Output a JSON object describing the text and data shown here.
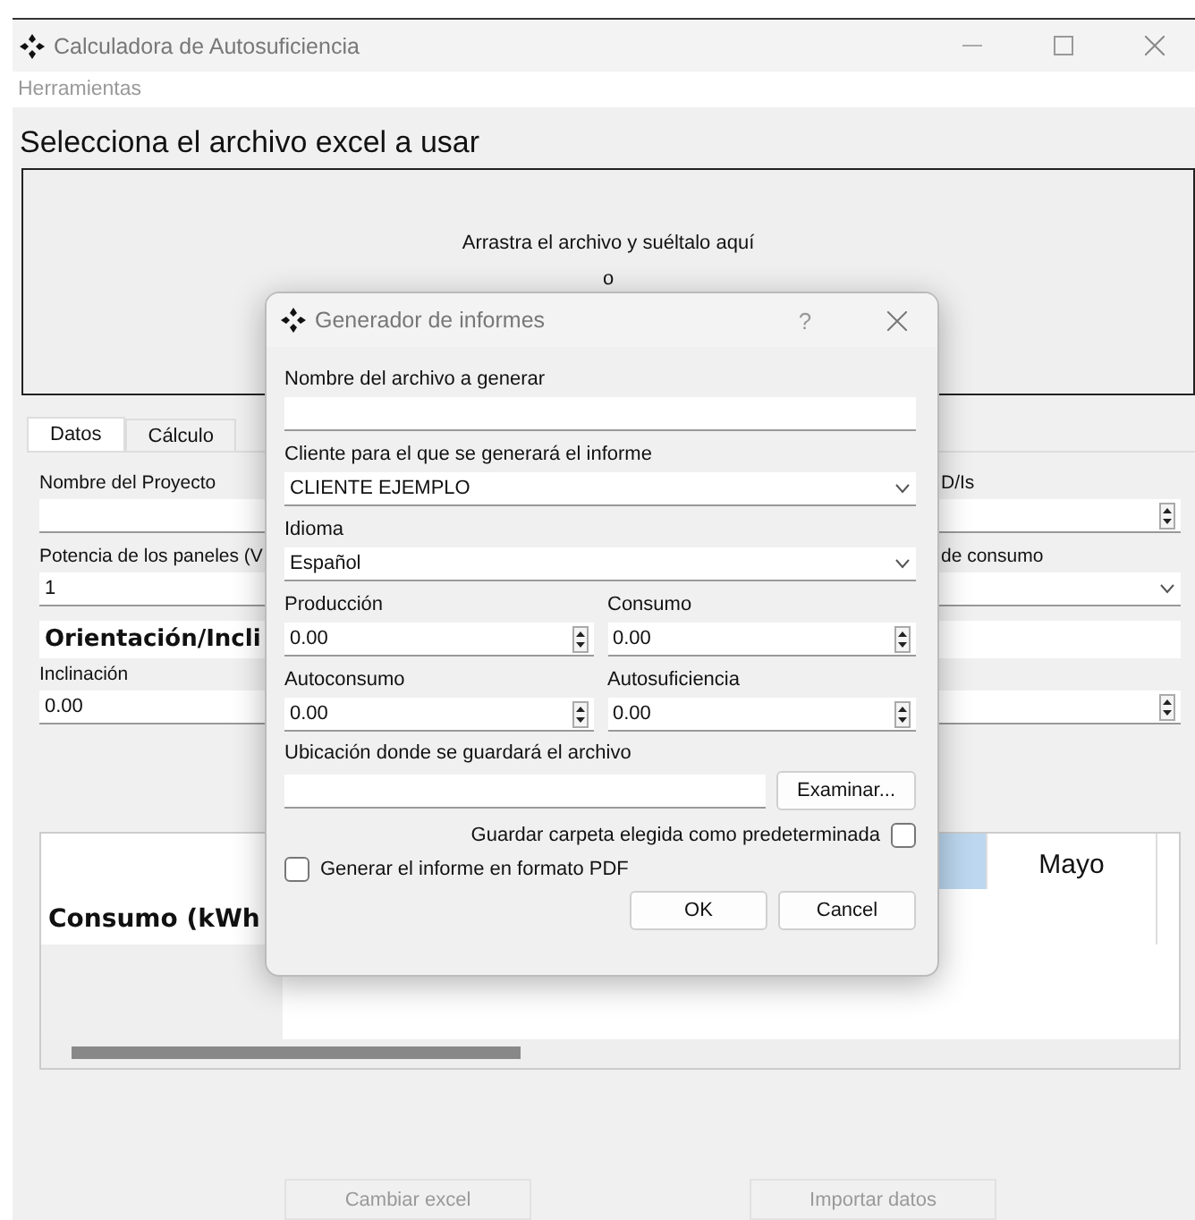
{
  "window": {
    "title": "Calculadora de Autosuficiencia"
  },
  "menu": [
    "Herramientas"
  ],
  "heading": "Selecciona el archivo excel a usar",
  "drop_zone": {
    "lines": [
      "Arrastra el archivo y suéltalo aquí",
      "o"
    ]
  },
  "tabs": [
    {
      "label": "Datos",
      "selected": true
    },
    {
      "label": "Cálculo",
      "selected": false
    }
  ],
  "form_left": [
    {
      "kind": "text",
      "label": "Nombre del Proyecto"
    },
    {
      "kind": "text",
      "label": "Potencia de los paneles (V",
      "value": "1"
    },
    {
      "kind": "section",
      "label": "Orientación/Incli"
    },
    {
      "kind": "spin",
      "label": "Inclinación",
      "value": "0.00"
    }
  ],
  "form_right": [
    {
      "kind": "spin",
      "label": "D/Is"
    },
    {
      "kind": "combo",
      "label": "de consumo"
    },
    {
      "kind": "section"
    },
    {
      "kind": "spin"
    }
  ],
  "table": {
    "row_header": "Consumo (kWh",
    "columns": [
      {
        "selected": true
      },
      {
        "label": "Mayo",
        "selected": false
      }
    ]
  },
  "buttons": [
    {
      "label": "Cambiar excel",
      "disabled": true
    },
    {
      "label": "Importar datos",
      "disabled": true
    }
  ],
  "dialog": {
    "title": "Generador de informes",
    "help": "?",
    "fields": [
      {
        "kind": "text",
        "label": "Nombre del archivo a generar"
      },
      {
        "kind": "combo",
        "label": "Cliente para el que se generará el informe",
        "value": "CLIENTE EJEMPLO"
      },
      {
        "kind": "combo",
        "label": "Idioma",
        "value": "Español"
      }
    ],
    "spins": [
      {
        "label": "Producción",
        "value": "0.00"
      },
      {
        "label": "Consumo",
        "value": "0.00"
      },
      {
        "label": "Autoconsumo",
        "value": "0.00"
      },
      {
        "label": "Autosuficiencia",
        "value": "0.00"
      }
    ],
    "location": {
      "label": "Ubicación donde se guardará el archivo",
      "browse": "Examinar..."
    },
    "save_default": {
      "label": "Guardar carpeta elegida como predeterminada",
      "checked": false
    },
    "pdf": {
      "label": "Generar el informe en formato PDF",
      "checked": false
    },
    "buttons": [
      "OK",
      "Cancel"
    ]
  }
}
